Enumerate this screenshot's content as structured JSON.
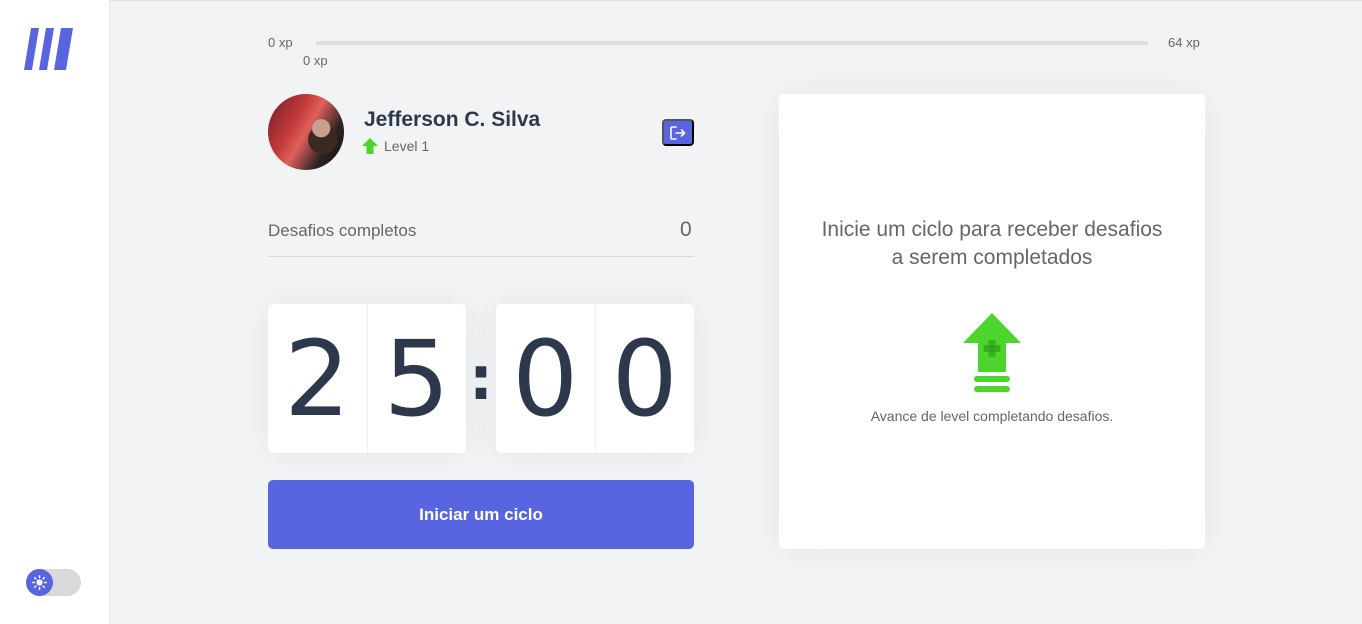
{
  "sidebar": {
    "logo_icon": "moveit-logo",
    "theme_toggle_icon": "sun-icon",
    "colors": {
      "accent": "#5965e0"
    }
  },
  "xp": {
    "start_label": "0 xp",
    "end_label": "64 xp",
    "current_label": "0 xp",
    "progress": 0,
    "fill_color": "#4cd62b"
  },
  "profile": {
    "name": "Jefferson C. Silva",
    "level_label": "Level 1",
    "level_icon": "level-up-arrow-icon",
    "logout_icon": "logout-icon"
  },
  "completed": {
    "label": "Desafios completos",
    "value": "0"
  },
  "countdown": {
    "minute_left": "2",
    "minute_right": "5",
    "separator": ":",
    "second_left": "0",
    "second_right": "0"
  },
  "actions": {
    "start_label": "Iniciar um ciclo"
  },
  "challenge_box": {
    "title_line1": "Inicie um ciclo para receber desafios",
    "title_line2": "a serem completados",
    "icon": "level-up-icon",
    "hint": "Avance de level completando desafios."
  },
  "colors": {
    "primary": "#5965e0",
    "green": "#4cd62b",
    "title": "#2e384d",
    "text": "#666666",
    "background": "#f2f3f5"
  }
}
